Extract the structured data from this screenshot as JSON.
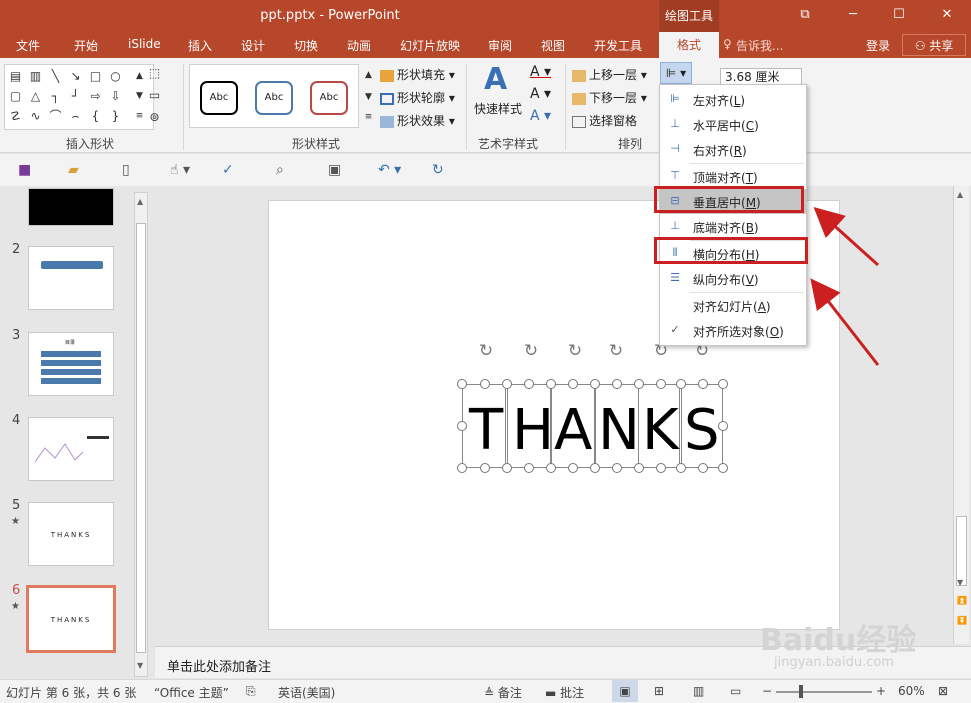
{
  "titlebar": {
    "document_title": "ppt.pptx - PowerPoint",
    "context_tab_title": "绘图工具",
    "restore_glyph": "⧉",
    "minimize_glyph": "─",
    "maximize_glyph": "☐",
    "close_glyph": "✕"
  },
  "tabs": {
    "file": "文件",
    "home": "开始",
    "islide": "iSlide",
    "insert": "插入",
    "design": "设计",
    "transitions": "切换",
    "animations": "动画",
    "slideshow": "幻灯片放映",
    "review": "审阅",
    "view": "视图",
    "developer": "开发工具",
    "format": "格式",
    "tell_me": "告诉我...",
    "login": "登录",
    "share": "共享"
  },
  "ribbon": {
    "insert_shapes_label": "插入形状",
    "shape_styles_label": "形状样式",
    "wordart_label": "艺术字样式",
    "arrange_label": "排列",
    "abc_label": "Abc",
    "shape_fill": "形状填充",
    "shape_outline": "形状轮廓",
    "shape_effects": "形状效果",
    "quick_styles": "快速样式",
    "bring_forward": "上移一层",
    "send_backward": "下移一层",
    "selection_pane": "选择窗格",
    "size_value": "3.68 厘米",
    "style_colors": [
      "#000000",
      "#4a7aab",
      "#b94a46"
    ]
  },
  "align_menu": {
    "items": [
      {
        "label": "左对齐(",
        "key": "L",
        "end": ")"
      },
      {
        "label": "水平居中(",
        "key": "C",
        "end": ")"
      },
      {
        "label": "右对齐(",
        "key": "R",
        "end": ")"
      },
      {
        "label": "顶端对齐(",
        "key": "T",
        "end": ")"
      },
      {
        "label": "垂直居中(",
        "key": "M",
        "end": ")"
      },
      {
        "label": "底端对齐(",
        "key": "B",
        "end": ")"
      },
      {
        "label": "横向分布(",
        "key": "H",
        "end": ")"
      },
      {
        "label": "纵向分布(",
        "key": "V",
        "end": ")"
      },
      {
        "label": "对齐幻灯片(",
        "key": "A",
        "end": ")"
      },
      {
        "label": "对齐所选对象(",
        "key": "O",
        "end": ")"
      }
    ],
    "checked_glyph": "✓"
  },
  "thumbnails": {
    "numbers": [
      "2",
      "3",
      "4",
      "5",
      "6"
    ],
    "star": "★",
    "thumb_text": "THANKS",
    "thumb3_title": "目录"
  },
  "slide": {
    "letters": [
      "T",
      "H",
      "A",
      "N",
      "K",
      "S"
    ]
  },
  "notes": {
    "placeholder": "单击此处添加备注"
  },
  "statusbar": {
    "slide_info": "幻灯片 第 6 张，共 6 张",
    "theme": "“Office 主题”",
    "language": "英语(美国)",
    "notes_btn": "备注",
    "comments_btn": "批注",
    "zoom": "60%"
  },
  "watermark": {
    "brand": "Baidu经验",
    "url": "jingyan.baidu.com"
  }
}
